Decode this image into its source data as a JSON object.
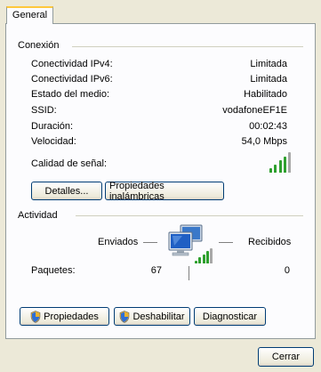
{
  "tab": {
    "label": "General"
  },
  "connection": {
    "title": "Conexión",
    "rows": [
      {
        "label": "Conectividad IPv4:",
        "value": "Limitada"
      },
      {
        "label": "Conectividad IPv6:",
        "value": "Limitada"
      },
      {
        "label": "Estado del medio:",
        "value": "Habilitado"
      },
      {
        "label": "SSID:",
        "value": "vodafoneEF1E"
      },
      {
        "label": "Duración:",
        "value": "00:02:43"
      },
      {
        "label": "Velocidad:",
        "value": "54,0 Mbps"
      }
    ],
    "signal_label": "Calidad de señal:",
    "signal_level": 4,
    "signal_max": 5,
    "details_button": "Detalles...",
    "wireless_button": "Propiedades inalámbricas"
  },
  "activity": {
    "title": "Actividad",
    "sent_label": "Enviados",
    "received_label": "Recibidos",
    "packets_label": "Paquetes:",
    "packets_sent": "67",
    "packets_received": "0",
    "activity_signal_level": 4,
    "activity_signal_max": 5
  },
  "actions": {
    "properties": "Propiedades",
    "disable": "Deshabilitar",
    "diagnose": "Diagnosticar"
  },
  "footer": {
    "close": "Cerrar"
  },
  "colors": {
    "signal_on": "#2ea02e",
    "signal_off": "#a8a8a8",
    "accent": "#003c74"
  }
}
